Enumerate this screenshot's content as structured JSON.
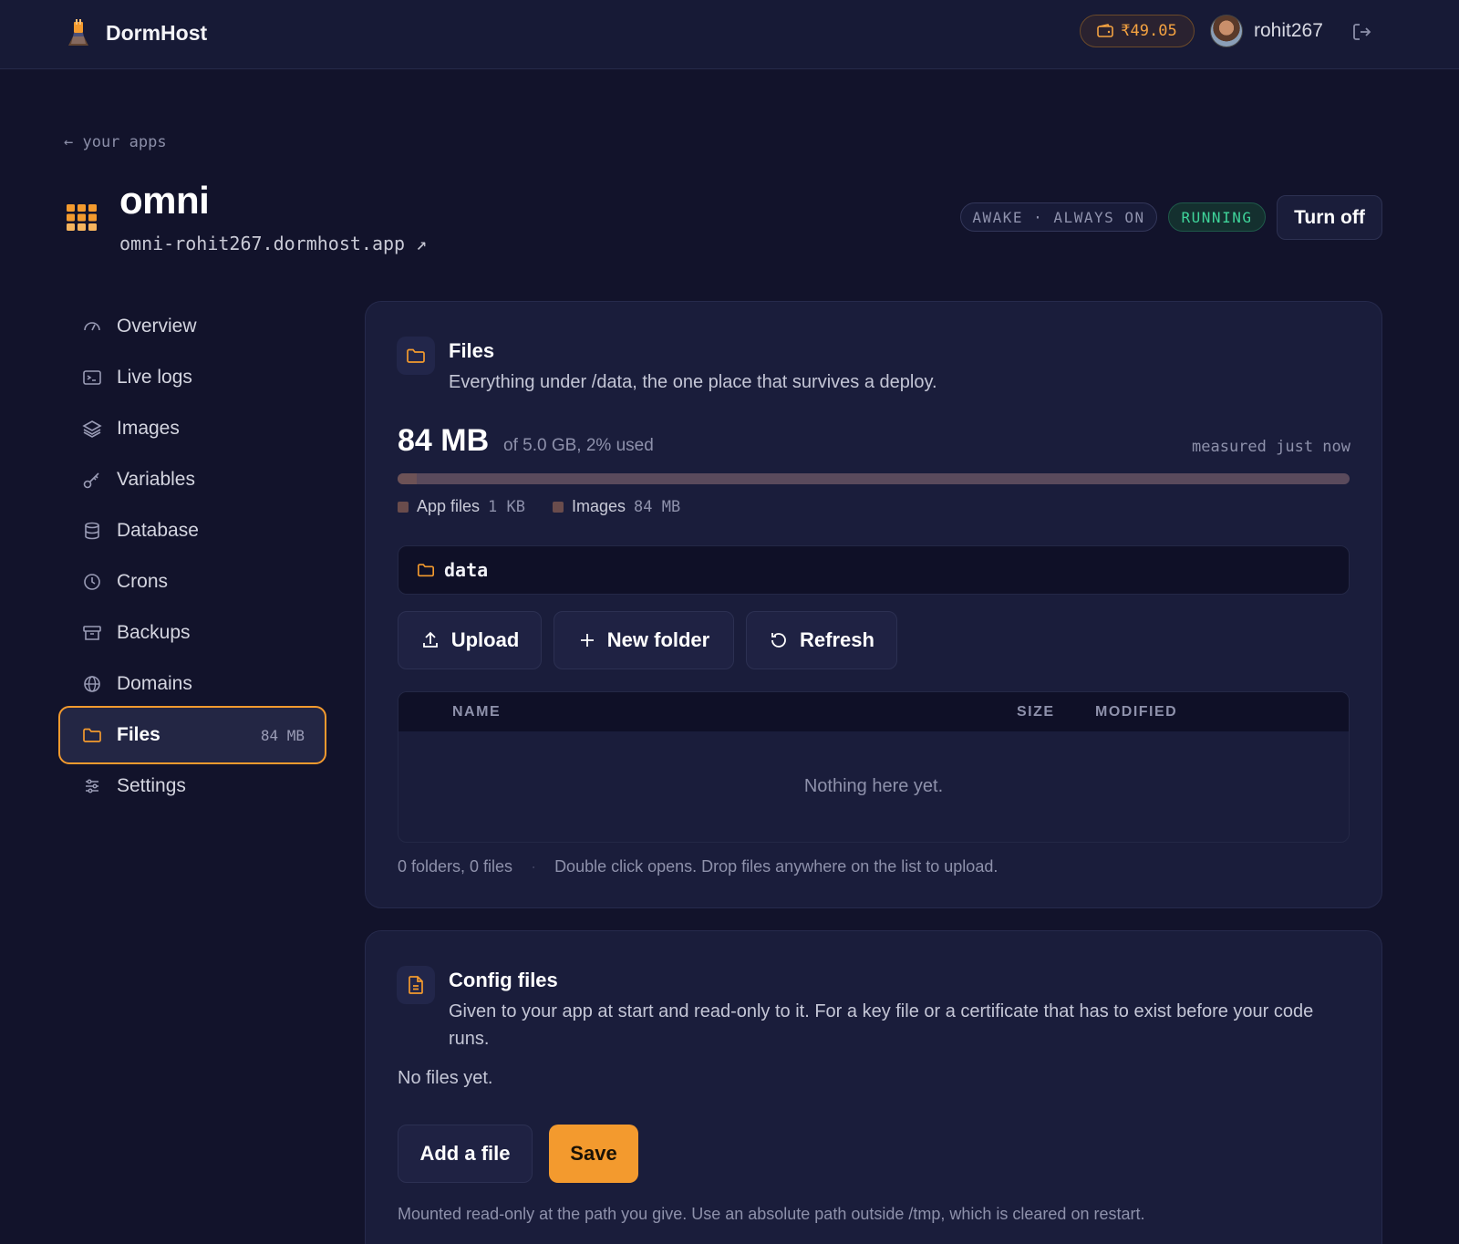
{
  "topbar": {
    "brand_name": "DormHost",
    "balance": "₹49.05",
    "username": "rohit267",
    "icons": [
      "wallet-icon",
      "avatar",
      "logout-icon"
    ]
  },
  "header": {
    "back_link": "← your apps",
    "app_name": "omni",
    "app_url": "omni-rohit267.dormhost.app ↗",
    "status_awake": "AWAKE · ALWAYS ON",
    "status_running": "RUNNING",
    "turn_off_label": "Turn off"
  },
  "sidebar": {
    "items": [
      {
        "label": "Overview",
        "icon": "gauge-icon"
      },
      {
        "label": "Live logs",
        "icon": "terminal-icon"
      },
      {
        "label": "Images",
        "icon": "layers-icon"
      },
      {
        "label": "Variables",
        "icon": "key-icon"
      },
      {
        "label": "Database",
        "icon": "database-icon"
      },
      {
        "label": "Crons",
        "icon": "clock-icon"
      },
      {
        "label": "Backups",
        "icon": "archive-icon"
      },
      {
        "label": "Domains",
        "icon": "globe-icon"
      },
      {
        "label": "Files",
        "icon": "folder-icon",
        "badge": "84 MB",
        "active": true
      },
      {
        "label": "Settings",
        "icon": "sliders-icon"
      }
    ]
  },
  "files_card": {
    "title": "Files",
    "description": "Everything under /data, the one place that survives a deploy.",
    "usage_value": "84 MB",
    "usage_of": "of 5.0 GB, 2% used",
    "usage_percent": 2,
    "measured": "measured just now",
    "legend": [
      {
        "label": "App files",
        "value": "1 KB"
      },
      {
        "label": "Images",
        "value": "84 MB"
      }
    ],
    "path": "data",
    "actions": {
      "upload": "Upload",
      "new_folder": "New folder",
      "refresh": "Refresh"
    },
    "table": {
      "col_name": "NAME",
      "col_size": "SIZE",
      "col_modified": "MODIFIED",
      "empty": "Nothing here yet."
    },
    "footer_counts": "0 folders, 0 files",
    "footer_sep": "·",
    "footer_hint": "Double click opens. Drop files anywhere on the list to upload."
  },
  "config_card": {
    "title": "Config files",
    "description": "Given to your app at start and read-only to it. For a key file or a certificate that has to exist before your code runs.",
    "no_files": "No files yet.",
    "add_label": "Add a file",
    "save_label": "Save",
    "footer": "Mounted read-only at the path you give. Use an absolute path outside /tmp, which is cleared on restart."
  },
  "colors": {
    "accent": "#f39a2e",
    "running": "#3fd49a",
    "background": "#12132b"
  }
}
